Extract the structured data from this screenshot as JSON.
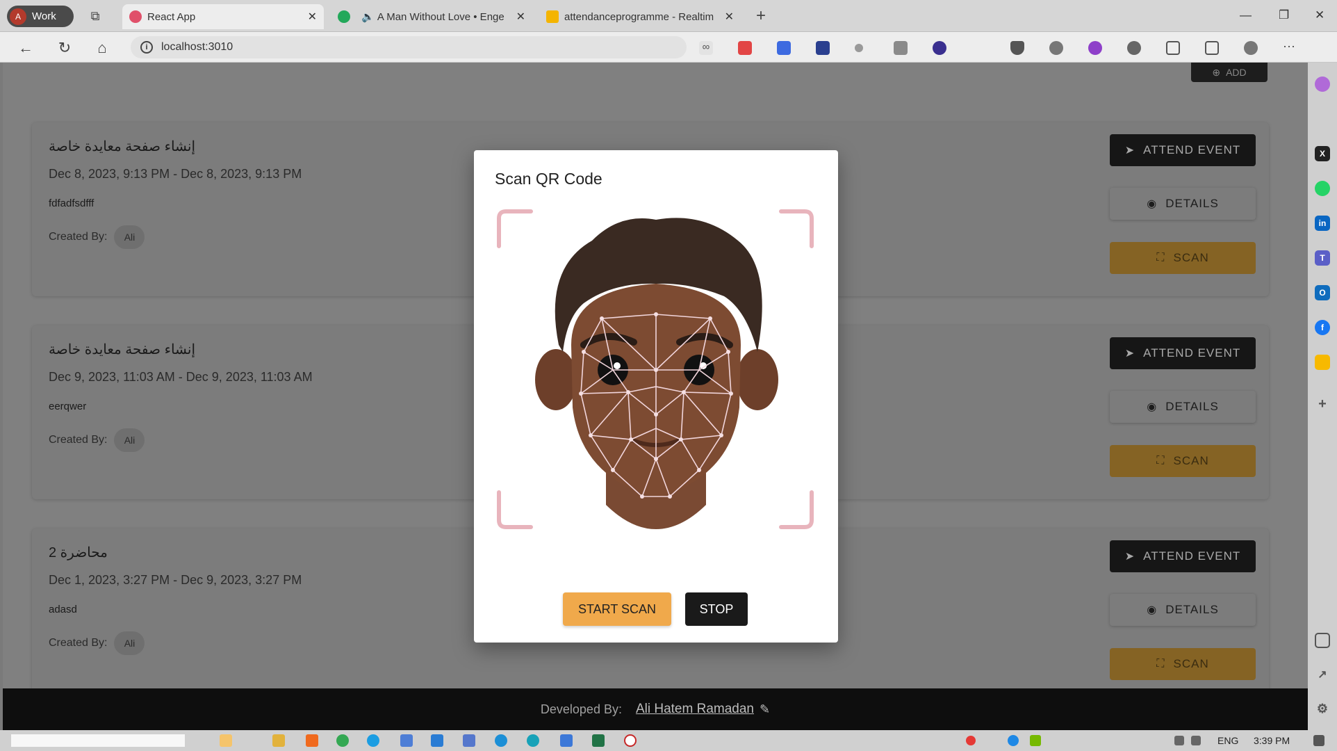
{
  "browser": {
    "profile": "Work",
    "tabs": [
      {
        "title": "React App",
        "active": true
      },
      {
        "title": "A Man Without Love • Enge",
        "active": false
      },
      {
        "title": "attendanceprogramme - Realtim",
        "active": false
      }
    ],
    "url": "localhost:3010"
  },
  "page": {
    "add_label": "ADD",
    "events": [
      {
        "title": "إنشاء صفحة معايدة خاصة",
        "dates": "Dec 8, 2023, 9:13 PM - Dec 8, 2023, 9:13 PM",
        "description": "fdfadfsdfff",
        "created_label": "Created By:",
        "creator": "Ali",
        "attend_label": "ATTEND EVENT",
        "details_label": "DETAILS",
        "scan_label": "SCAN"
      },
      {
        "title": "إنشاء صفحة معايدة خاصة",
        "dates": "Dec 9, 2023, 11:03 AM - Dec 9, 2023, 11:03 AM",
        "description": "eerqwer",
        "created_label": "Created By:",
        "creator": "Ali",
        "attend_label": "ATTEND EVENT",
        "details_label": "DETAILS",
        "scan_label": "SCAN"
      },
      {
        "title": "محاضرة 2",
        "dates": "Dec 1, 2023, 3:27 PM - Dec 9, 2023, 3:27 PM",
        "description": "adasd",
        "created_label": "Created By:",
        "creator": "Ali",
        "attend_label": "ATTEND EVENT",
        "details_label": "DETAILS",
        "scan_label": "SCAN"
      }
    ]
  },
  "modal": {
    "title": "Scan QR Code",
    "start_label": "START SCAN",
    "stop_label": "STOP"
  },
  "footer": {
    "label": "Developed By:",
    "author": "Ali Hatem Ramadan"
  },
  "taskbar": {
    "language": "ENG",
    "time": "3:39 PM"
  },
  "icons": {
    "attend": "send-icon",
    "details": "eye-icon",
    "scan": "scan-frame-icon"
  },
  "colors": {
    "scan_button": "#f0a94b",
    "attend_button": "#161616",
    "footer": "#0e0e0e",
    "frame_corner": "#e8b4bc",
    "mesh": "#f2d6dc"
  }
}
